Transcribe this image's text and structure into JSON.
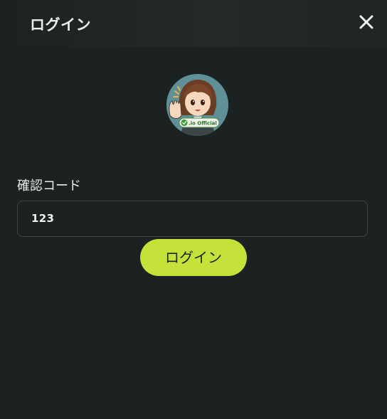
{
  "dialog": {
    "title": "ログイン"
  },
  "avatar": {
    "badge_text": ".io Official"
  },
  "form": {
    "code_label": "確認コード",
    "code_value": "123"
  },
  "actions": {
    "login_label": "ログイン"
  },
  "colors": {
    "background": "#1b2221",
    "accent": "#c4e23a",
    "text": "#eef0ee",
    "input_border": "#3f4645"
  },
  "icons": {
    "close": "close-icon",
    "avatar": "avatar-image"
  }
}
